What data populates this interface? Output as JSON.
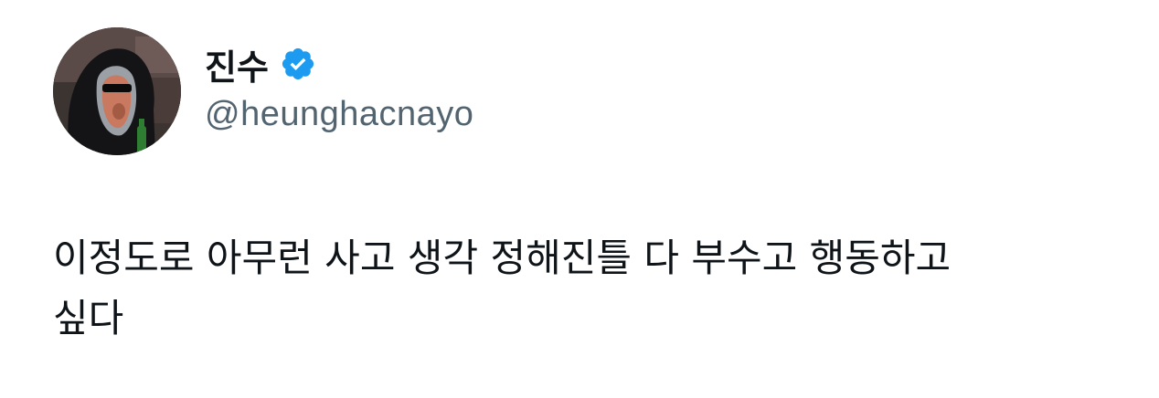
{
  "author": {
    "display_name": "진수",
    "handle": "@heunghacnayo",
    "verified": true,
    "verified_color": "#1d9bf0",
    "avatar_icon": "hooded-figure-with-sunglasses-avatar"
  },
  "tweet": {
    "text": "이정도로 아무런 사고 생각 정해진틀 다 부수고 행동하고\n싶다"
  },
  "colors": {
    "text_primary": "#0f1419",
    "text_secondary": "#536471",
    "background": "#ffffff"
  }
}
